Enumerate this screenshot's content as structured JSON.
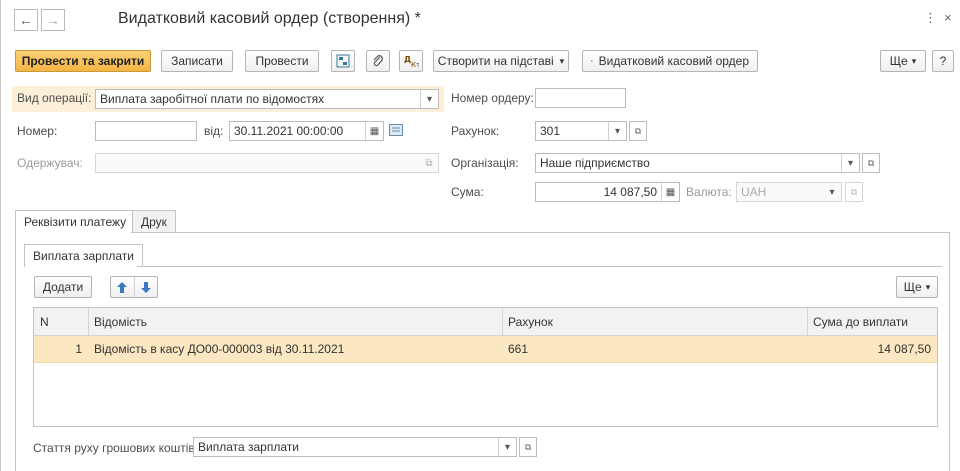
{
  "window": {
    "title": "Видатковий касовий ордер (створення) *",
    "more_glyph": "⋮",
    "close_glyph": "×"
  },
  "nav": {
    "back_glyph": "←",
    "forward_glyph": "→"
  },
  "toolbar": {
    "post_close": "Провести та закрити",
    "save": "Записати",
    "post": "Провести",
    "create_based": "Створити на підставі",
    "print_doc": "Видатковий касовий ордер",
    "more": "Ще",
    "help": "?"
  },
  "form": {
    "operation_label": "Вид операції:",
    "operation_value": "Виплата заробітної плати по відомостях",
    "order_no_label": "Номер ордеру:",
    "order_no_value": "",
    "number_label": "Номер:",
    "number_value": "",
    "date_label": "від:",
    "date_value": "30.11.2021 00:00:00",
    "account_label": "Рахунок:",
    "account_value": "301",
    "recipient_label": "Одержувач:",
    "recipient_value": "",
    "org_label": "Організація:",
    "org_value": "Наше підприємство",
    "sum_label": "Сума:",
    "sum_value": "14 087,50",
    "currency_label": "Валюта:",
    "currency_value": "UAH"
  },
  "tabs": [
    {
      "label": "Реквізити платежу",
      "active": true
    },
    {
      "label": "Друк",
      "active": false
    }
  ],
  "subtab": {
    "label": "Виплата зарплати"
  },
  "table_toolbar": {
    "add": "Додати",
    "more": "Ще"
  },
  "table": {
    "columns": [
      "N",
      "Відомість",
      "Рахунок",
      "Сума до виплати"
    ],
    "rows": [
      {
        "n": "1",
        "statement": "Відомість в касу ДО00-000003 від 30.11.2021",
        "account": "661",
        "amount": "14 087,50"
      }
    ]
  },
  "cashflow": {
    "label": "Стаття руху грошових коштів:",
    "value": "Виплата зарплати"
  },
  "colors": {
    "primary_button": "#f4b443",
    "selected_row": "#fbe7c2",
    "operation_highlight": "#fdf0d8"
  }
}
